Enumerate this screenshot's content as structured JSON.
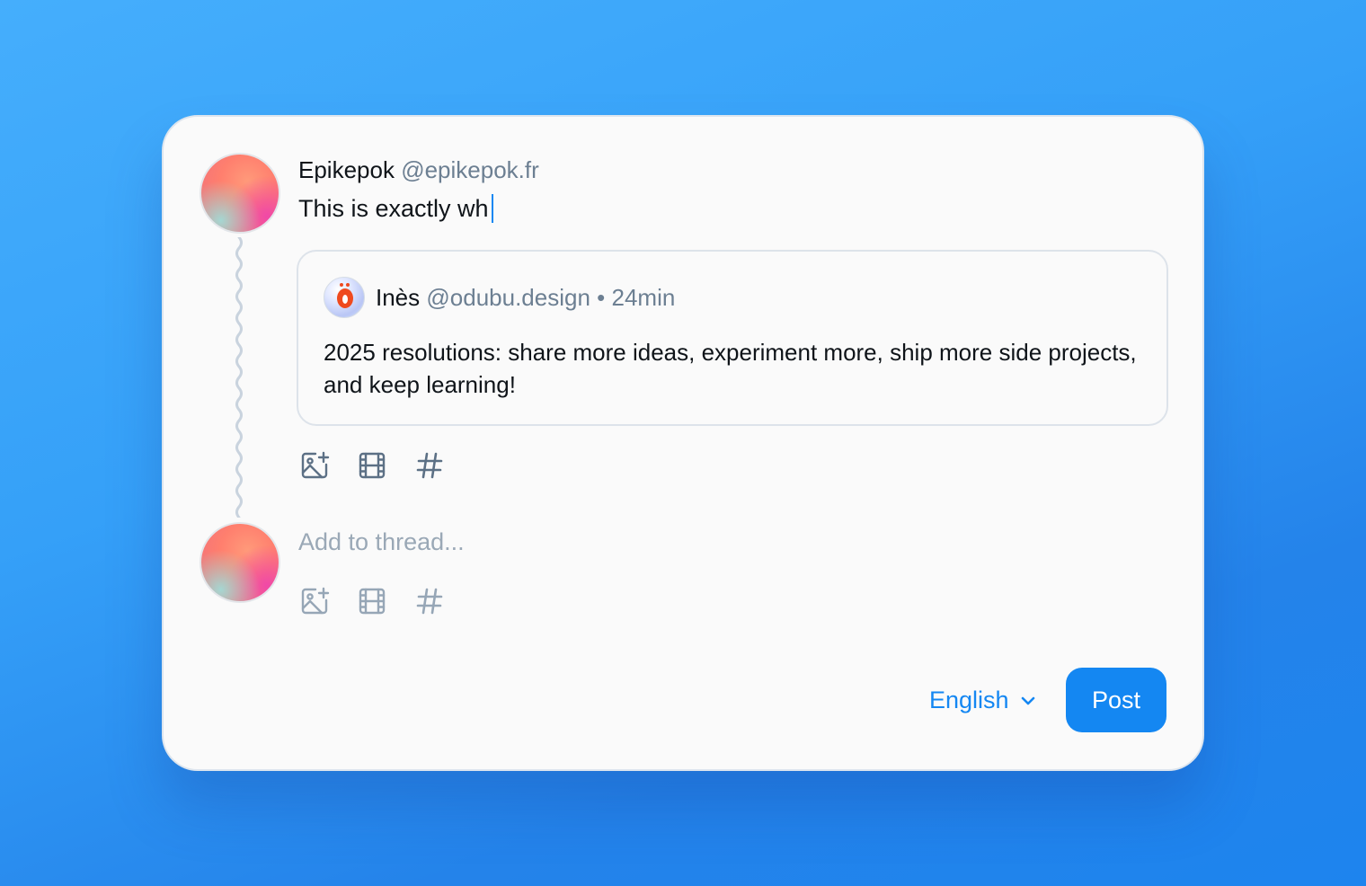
{
  "composer": {
    "author_name": "Epikepok",
    "author_handle": "@epikepok.fr",
    "text": "This is exactly wh"
  },
  "quote": {
    "author_name": "Inès",
    "author_handle": "@odubu.design",
    "separator": "•",
    "time_ago": "24min",
    "body": "2025 resolutions: share more ideas, experiment more, ship more side projects, and keep learning!"
  },
  "toolbar_icons": [
    "add-image-icon",
    "video-icon",
    "hashtag-icon"
  ],
  "thread": {
    "placeholder": "Add to thread..."
  },
  "footer": {
    "language": "English",
    "post_label": "Post"
  },
  "colors": {
    "accent": "#1487f2",
    "handle": "#6c7f92",
    "placeholder": "#9aa8b6",
    "card_bg": "#fafafa"
  }
}
